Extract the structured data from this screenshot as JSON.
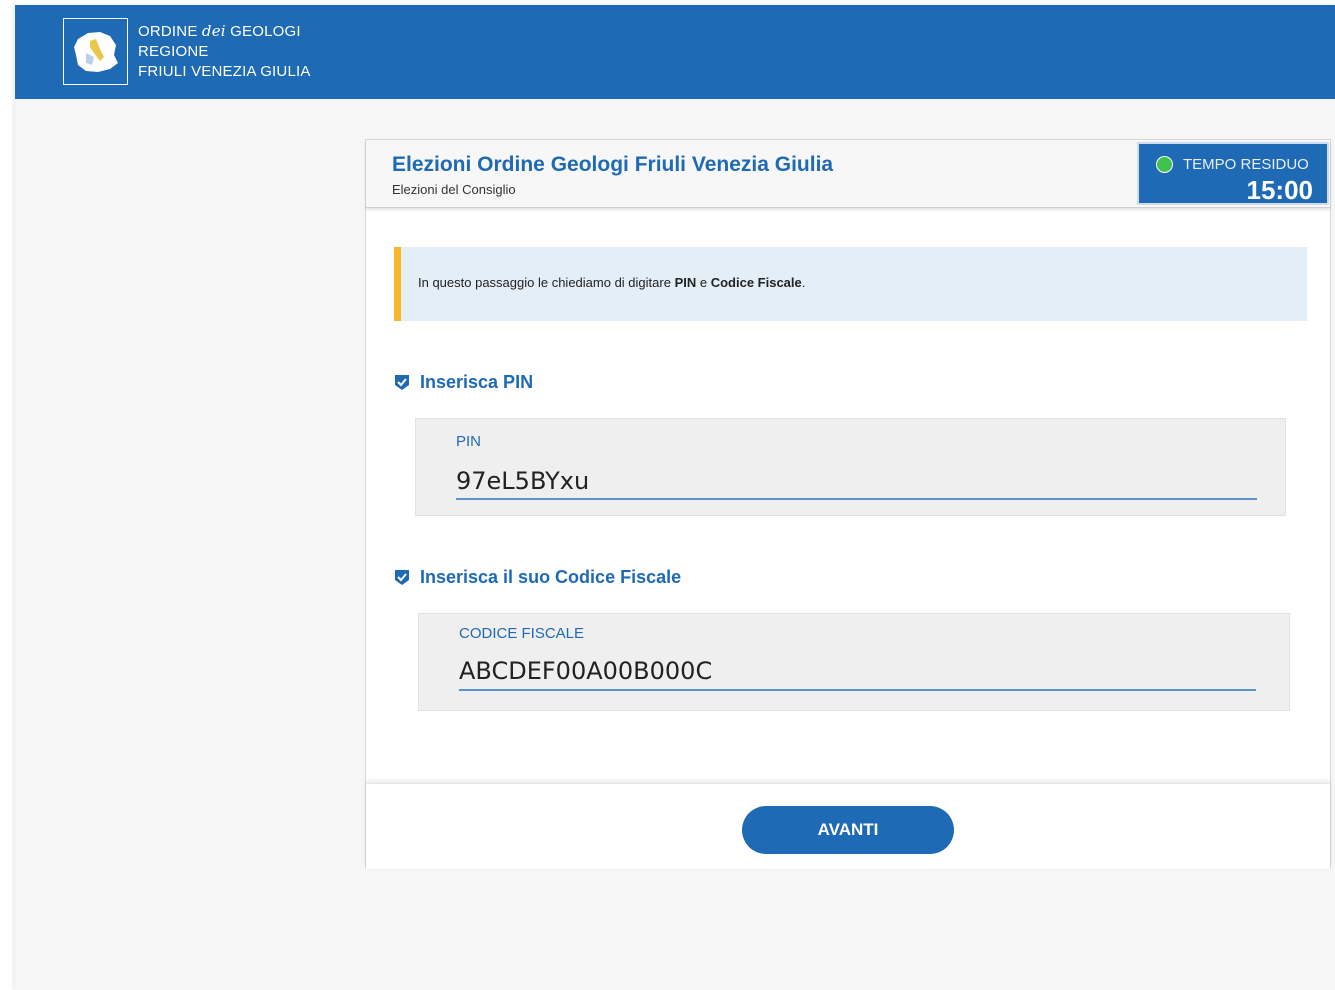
{
  "header": {
    "logo_line1_prefix": "ORDINE ",
    "logo_line1_italic": "dei",
    "logo_line1_suffix": " GEOLOGI",
    "logo_line2": "REGIONE",
    "logo_line3": "FRIULI VENEZIA GIULIA"
  },
  "card": {
    "title": "Elezioni Ordine Geologi Friuli Venezia Giulia",
    "subtitle": "Elezioni del Consiglio",
    "timer_label": "TEMPO RESIDUO",
    "timer_value": "15:00"
  },
  "info": {
    "text_before": "In questo passaggio le chiediamo di digitare ",
    "bold1": "PIN",
    "text_middle": " e ",
    "bold2": "Codice Fiscale",
    "text_after": "."
  },
  "pin_section": {
    "heading": "Inserisca PIN",
    "label": "PIN",
    "value": "97eL5BYxu"
  },
  "cf_section": {
    "heading": "Inserisca il suo Codice Fiscale",
    "label": "CODICE FISCALE",
    "value": "ABCDEF00A00B000C"
  },
  "footer": {
    "next_label": "AVANTI"
  },
  "colors": {
    "primary": "#1e6ab4",
    "accent_bar": "#f6b82a",
    "timer_dot": "#3ec24b"
  }
}
